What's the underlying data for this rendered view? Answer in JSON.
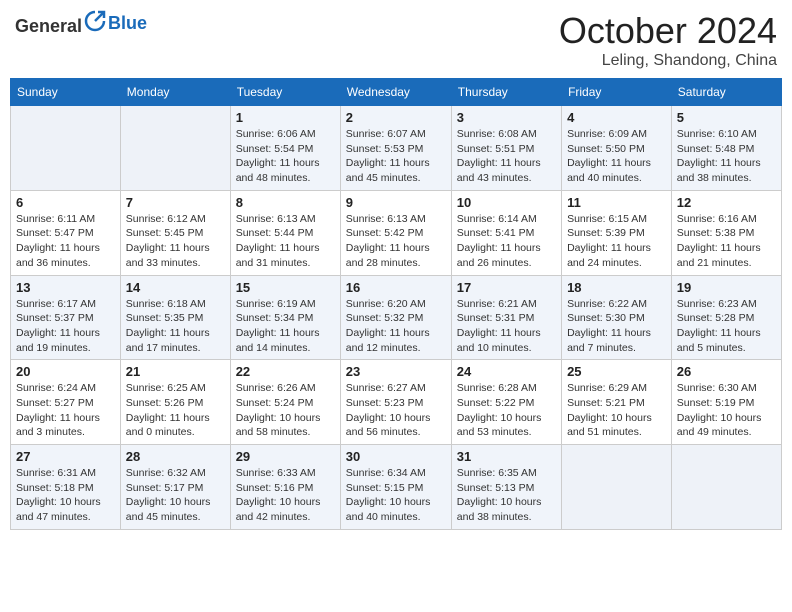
{
  "header": {
    "logo_general": "General",
    "logo_blue": "Blue",
    "month": "October 2024",
    "location": "Leling, Shandong, China"
  },
  "weekdays": [
    "Sunday",
    "Monday",
    "Tuesday",
    "Wednesday",
    "Thursday",
    "Friday",
    "Saturday"
  ],
  "weeks": [
    [
      {
        "day": "",
        "empty": true
      },
      {
        "day": "",
        "empty": true
      },
      {
        "day": "1",
        "sunrise": "Sunrise: 6:06 AM",
        "sunset": "Sunset: 5:54 PM",
        "daylight": "Daylight: 11 hours and 48 minutes."
      },
      {
        "day": "2",
        "sunrise": "Sunrise: 6:07 AM",
        "sunset": "Sunset: 5:53 PM",
        "daylight": "Daylight: 11 hours and 45 minutes."
      },
      {
        "day": "3",
        "sunrise": "Sunrise: 6:08 AM",
        "sunset": "Sunset: 5:51 PM",
        "daylight": "Daylight: 11 hours and 43 minutes."
      },
      {
        "day": "4",
        "sunrise": "Sunrise: 6:09 AM",
        "sunset": "Sunset: 5:50 PM",
        "daylight": "Daylight: 11 hours and 40 minutes."
      },
      {
        "day": "5",
        "sunrise": "Sunrise: 6:10 AM",
        "sunset": "Sunset: 5:48 PM",
        "daylight": "Daylight: 11 hours and 38 minutes."
      }
    ],
    [
      {
        "day": "6",
        "sunrise": "Sunrise: 6:11 AM",
        "sunset": "Sunset: 5:47 PM",
        "daylight": "Daylight: 11 hours and 36 minutes."
      },
      {
        "day": "7",
        "sunrise": "Sunrise: 6:12 AM",
        "sunset": "Sunset: 5:45 PM",
        "daylight": "Daylight: 11 hours and 33 minutes."
      },
      {
        "day": "8",
        "sunrise": "Sunrise: 6:13 AM",
        "sunset": "Sunset: 5:44 PM",
        "daylight": "Daylight: 11 hours and 31 minutes."
      },
      {
        "day": "9",
        "sunrise": "Sunrise: 6:13 AM",
        "sunset": "Sunset: 5:42 PM",
        "daylight": "Daylight: 11 hours and 28 minutes."
      },
      {
        "day": "10",
        "sunrise": "Sunrise: 6:14 AM",
        "sunset": "Sunset: 5:41 PM",
        "daylight": "Daylight: 11 hours and 26 minutes."
      },
      {
        "day": "11",
        "sunrise": "Sunrise: 6:15 AM",
        "sunset": "Sunset: 5:39 PM",
        "daylight": "Daylight: 11 hours and 24 minutes."
      },
      {
        "day": "12",
        "sunrise": "Sunrise: 6:16 AM",
        "sunset": "Sunset: 5:38 PM",
        "daylight": "Daylight: 11 hours and 21 minutes."
      }
    ],
    [
      {
        "day": "13",
        "sunrise": "Sunrise: 6:17 AM",
        "sunset": "Sunset: 5:37 PM",
        "daylight": "Daylight: 11 hours and 19 minutes."
      },
      {
        "day": "14",
        "sunrise": "Sunrise: 6:18 AM",
        "sunset": "Sunset: 5:35 PM",
        "daylight": "Daylight: 11 hours and 17 minutes."
      },
      {
        "day": "15",
        "sunrise": "Sunrise: 6:19 AM",
        "sunset": "Sunset: 5:34 PM",
        "daylight": "Daylight: 11 hours and 14 minutes."
      },
      {
        "day": "16",
        "sunrise": "Sunrise: 6:20 AM",
        "sunset": "Sunset: 5:32 PM",
        "daylight": "Daylight: 11 hours and 12 minutes."
      },
      {
        "day": "17",
        "sunrise": "Sunrise: 6:21 AM",
        "sunset": "Sunset: 5:31 PM",
        "daylight": "Daylight: 11 hours and 10 minutes."
      },
      {
        "day": "18",
        "sunrise": "Sunrise: 6:22 AM",
        "sunset": "Sunset: 5:30 PM",
        "daylight": "Daylight: 11 hours and 7 minutes."
      },
      {
        "day": "19",
        "sunrise": "Sunrise: 6:23 AM",
        "sunset": "Sunset: 5:28 PM",
        "daylight": "Daylight: 11 hours and 5 minutes."
      }
    ],
    [
      {
        "day": "20",
        "sunrise": "Sunrise: 6:24 AM",
        "sunset": "Sunset: 5:27 PM",
        "daylight": "Daylight: 11 hours and 3 minutes."
      },
      {
        "day": "21",
        "sunrise": "Sunrise: 6:25 AM",
        "sunset": "Sunset: 5:26 PM",
        "daylight": "Daylight: 11 hours and 0 minutes."
      },
      {
        "day": "22",
        "sunrise": "Sunrise: 6:26 AM",
        "sunset": "Sunset: 5:24 PM",
        "daylight": "Daylight: 10 hours and 58 minutes."
      },
      {
        "day": "23",
        "sunrise": "Sunrise: 6:27 AM",
        "sunset": "Sunset: 5:23 PM",
        "daylight": "Daylight: 10 hours and 56 minutes."
      },
      {
        "day": "24",
        "sunrise": "Sunrise: 6:28 AM",
        "sunset": "Sunset: 5:22 PM",
        "daylight": "Daylight: 10 hours and 53 minutes."
      },
      {
        "day": "25",
        "sunrise": "Sunrise: 6:29 AM",
        "sunset": "Sunset: 5:21 PM",
        "daylight": "Daylight: 10 hours and 51 minutes."
      },
      {
        "day": "26",
        "sunrise": "Sunrise: 6:30 AM",
        "sunset": "Sunset: 5:19 PM",
        "daylight": "Daylight: 10 hours and 49 minutes."
      }
    ],
    [
      {
        "day": "27",
        "sunrise": "Sunrise: 6:31 AM",
        "sunset": "Sunset: 5:18 PM",
        "daylight": "Daylight: 10 hours and 47 minutes."
      },
      {
        "day": "28",
        "sunrise": "Sunrise: 6:32 AM",
        "sunset": "Sunset: 5:17 PM",
        "daylight": "Daylight: 10 hours and 45 minutes."
      },
      {
        "day": "29",
        "sunrise": "Sunrise: 6:33 AM",
        "sunset": "Sunset: 5:16 PM",
        "daylight": "Daylight: 10 hours and 42 minutes."
      },
      {
        "day": "30",
        "sunrise": "Sunrise: 6:34 AM",
        "sunset": "Sunset: 5:15 PM",
        "daylight": "Daylight: 10 hours and 40 minutes."
      },
      {
        "day": "31",
        "sunrise": "Sunrise: 6:35 AM",
        "sunset": "Sunset: 5:13 PM",
        "daylight": "Daylight: 10 hours and 38 minutes."
      },
      {
        "day": "",
        "empty": true
      },
      {
        "day": "",
        "empty": true
      }
    ]
  ]
}
